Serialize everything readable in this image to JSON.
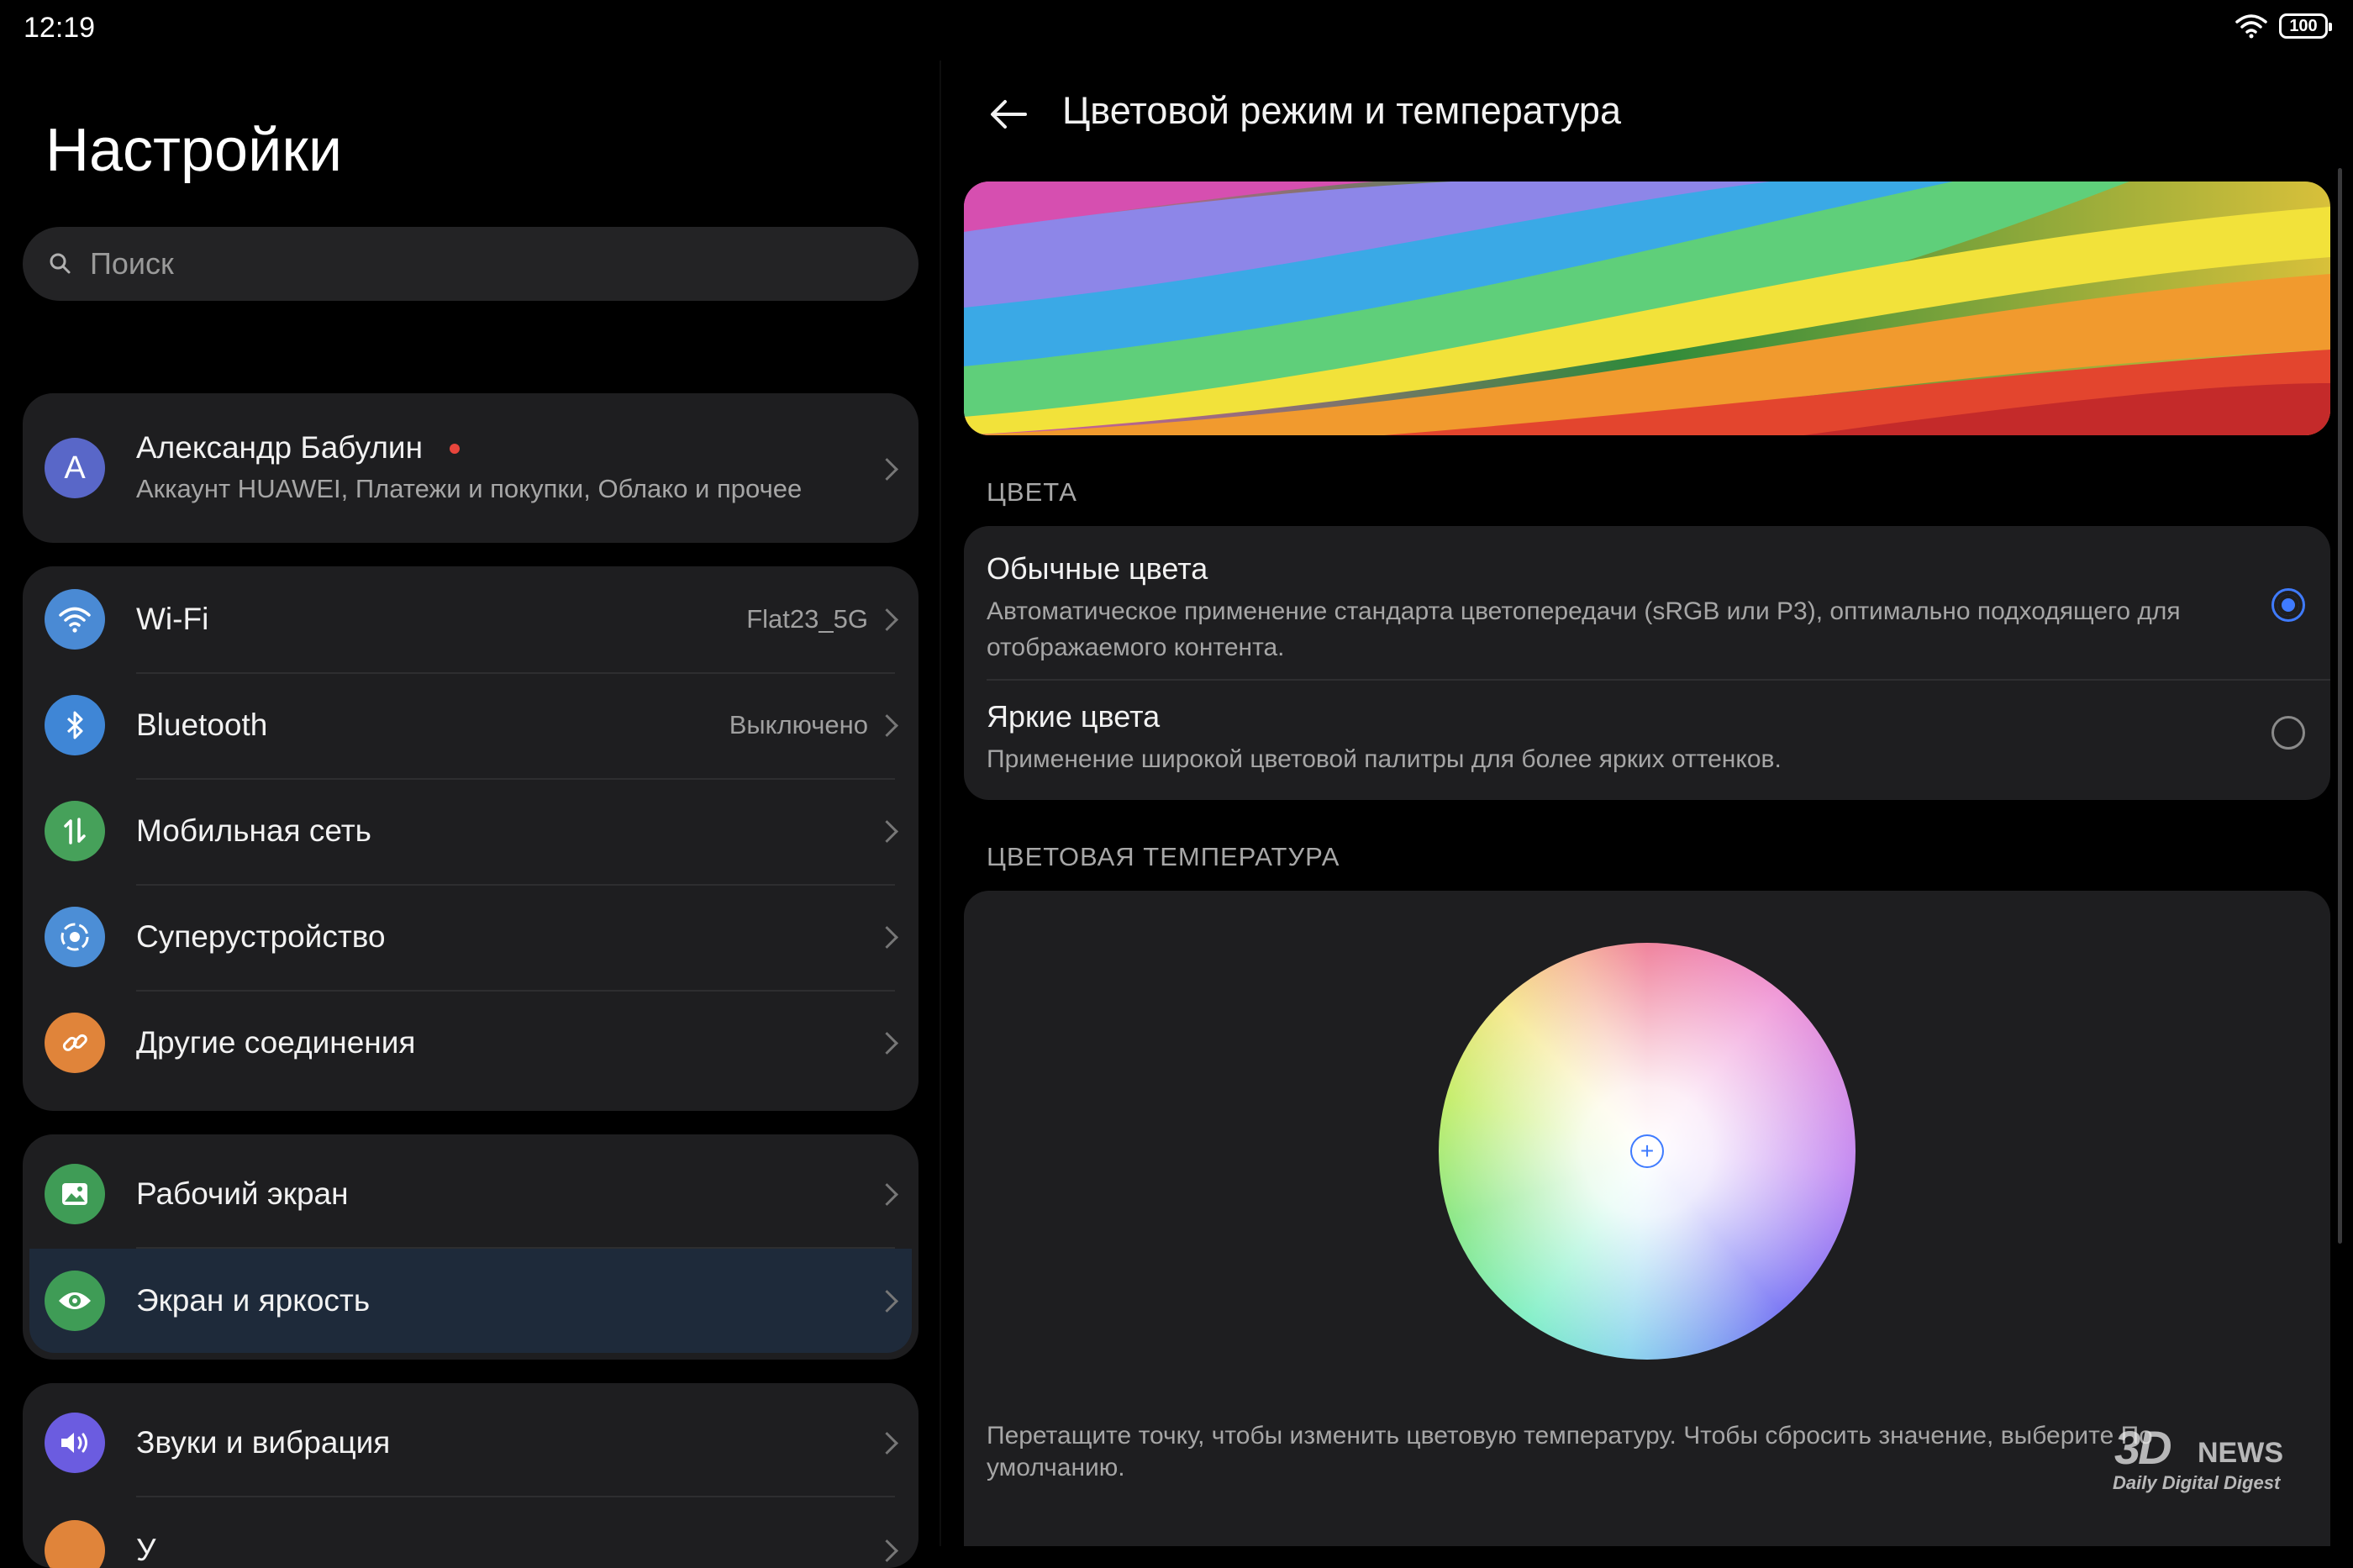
{
  "status_bar": {
    "time": "12:19",
    "battery": "100"
  },
  "settings": {
    "title": "Настройки",
    "search_placeholder": "Поиск",
    "account": {
      "avatar_letter": "А",
      "name": "Александр Бабулин",
      "subtitle": "Аккаунт HUAWEI, Платежи и покупки, Облако и прочее"
    },
    "network_group": [
      {
        "label": "Wi-Fi",
        "value": "Flat23_5G",
        "icon": "wifi-icon",
        "color": "#4a8ad4"
      },
      {
        "label": "Bluetooth",
        "value": "Выключено",
        "icon": "bluetooth-icon",
        "color": "#3f86d6"
      },
      {
        "label": "Мобильная сеть",
        "value": "",
        "icon": "mobile-data-icon",
        "color": "#46a15a"
      },
      {
        "label": "Суперустройство",
        "value": "",
        "icon": "superdevice-icon",
        "color": "#4c8ed6"
      },
      {
        "label": "Другие соединения",
        "value": "",
        "icon": "link-icon",
        "color": "#e0843a"
      }
    ],
    "display_group": [
      {
        "label": "Рабочий экран",
        "icon": "image-icon",
        "color": "#3f9c56"
      },
      {
        "label": "Экран и яркость",
        "icon": "eye-icon",
        "color": "#3f9c56",
        "selected": true
      }
    ],
    "sound_group": [
      {
        "label": "Звуки и вибрация",
        "icon": "volume-icon",
        "color": "#6b5ce0"
      },
      {
        "label": "У",
        "icon": "notification-icon",
        "color": "#e0843a"
      }
    ]
  },
  "detail": {
    "title": "Цветовой режим и температура",
    "colors_header": "ЦВЕТА",
    "options": [
      {
        "title": "Обычные цвета",
        "desc": "Автоматическое применение стандарта цветопередачи (sRGB или P3), оптимально подходящего для отображаемого контента.",
        "selected": true
      },
      {
        "title": "Яркие цвета",
        "desc": "Применение широкой цветовой палитры для более ярких оттенков.",
        "selected": false
      }
    ],
    "temperature_header": "ЦВЕТОВАЯ ТЕМПЕРАТУРА",
    "temperature_hint": "Перетащите точку, чтобы изменить цветовую температуру. Чтобы сбросить значение, выберите По умолчанию."
  },
  "watermark": {
    "brand": "3D",
    "brand_suffix": "NEWS",
    "tagline": "Daily Digital Digest"
  },
  "colors": {
    "accent": "#3f7bff",
    "card": "#1e1e20",
    "notification_dot": "#e8453c"
  }
}
